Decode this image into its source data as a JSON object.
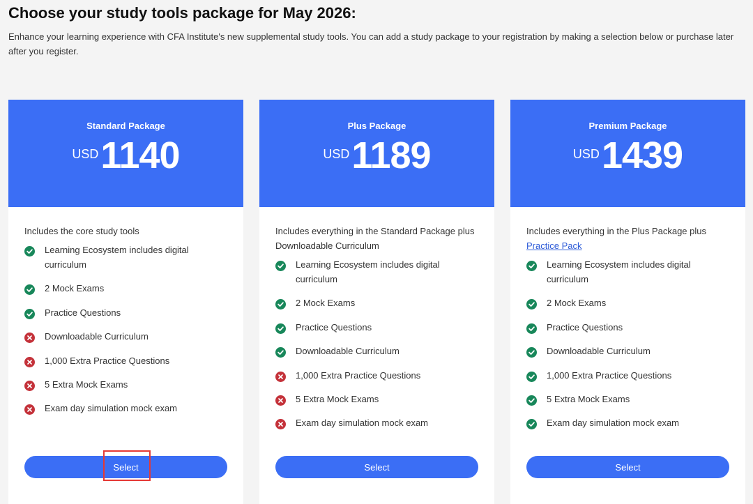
{
  "header": {
    "title": "Choose your study tools package for May 2026:",
    "intro": "Enhance your learning experience with CFA Institute's new supplemental study tools. You can add a study package to your registration by making a selection below or purchase later after you register."
  },
  "colors": {
    "accent": "#3b6ef5",
    "included": "#18875a",
    "excluded": "#c4323a",
    "highlight": "#e53935"
  },
  "packages": [
    {
      "name": "Standard Package",
      "currency": "USD",
      "price": "1140",
      "intro_text": "Includes the core study tools",
      "intro_link": "",
      "select_label": "Select",
      "features": [
        {
          "label": "Learning Ecosystem includes digital curriculum",
          "included": true
        },
        {
          "label": "2 Mock Exams",
          "included": true
        },
        {
          "label": "Practice Questions",
          "included": true
        },
        {
          "label": "Downloadable Curriculum",
          "included": false
        },
        {
          "label": "1,000 Extra Practice Questions",
          "included": false
        },
        {
          "label": "5 Extra Mock Exams",
          "included": false
        },
        {
          "label": "Exam day simulation mock exam",
          "included": false
        }
      ]
    },
    {
      "name": "Plus Package",
      "currency": "USD",
      "price": "1189",
      "intro_text": "Includes everything in the Standard Package plus Downloadable Curriculum",
      "intro_link": "",
      "select_label": "Select",
      "features": [
        {
          "label": "Learning Ecosystem includes digital curriculum",
          "included": true
        },
        {
          "label": "2 Mock Exams",
          "included": true
        },
        {
          "label": "Practice Questions",
          "included": true
        },
        {
          "label": "Downloadable Curriculum",
          "included": true
        },
        {
          "label": "1,000 Extra Practice Questions",
          "included": false
        },
        {
          "label": "5 Extra Mock Exams",
          "included": false
        },
        {
          "label": "Exam day simulation mock exam",
          "included": false
        }
      ]
    },
    {
      "name": "Premium Package",
      "currency": "USD",
      "price": "1439",
      "intro_text": "Includes everything in the Plus Package plus",
      "intro_link": "Practice Pack",
      "select_label": "Select",
      "features": [
        {
          "label": "Learning Ecosystem includes digital curriculum",
          "included": true
        },
        {
          "label": "2 Mock Exams",
          "included": true
        },
        {
          "label": "Practice Questions",
          "included": true
        },
        {
          "label": "Downloadable Curriculum",
          "included": true
        },
        {
          "label": "1,000 Extra Practice Questions",
          "included": true
        },
        {
          "label": "5 Extra Mock Exams",
          "included": true
        },
        {
          "label": "Exam day simulation mock exam",
          "included": true
        }
      ]
    }
  ]
}
